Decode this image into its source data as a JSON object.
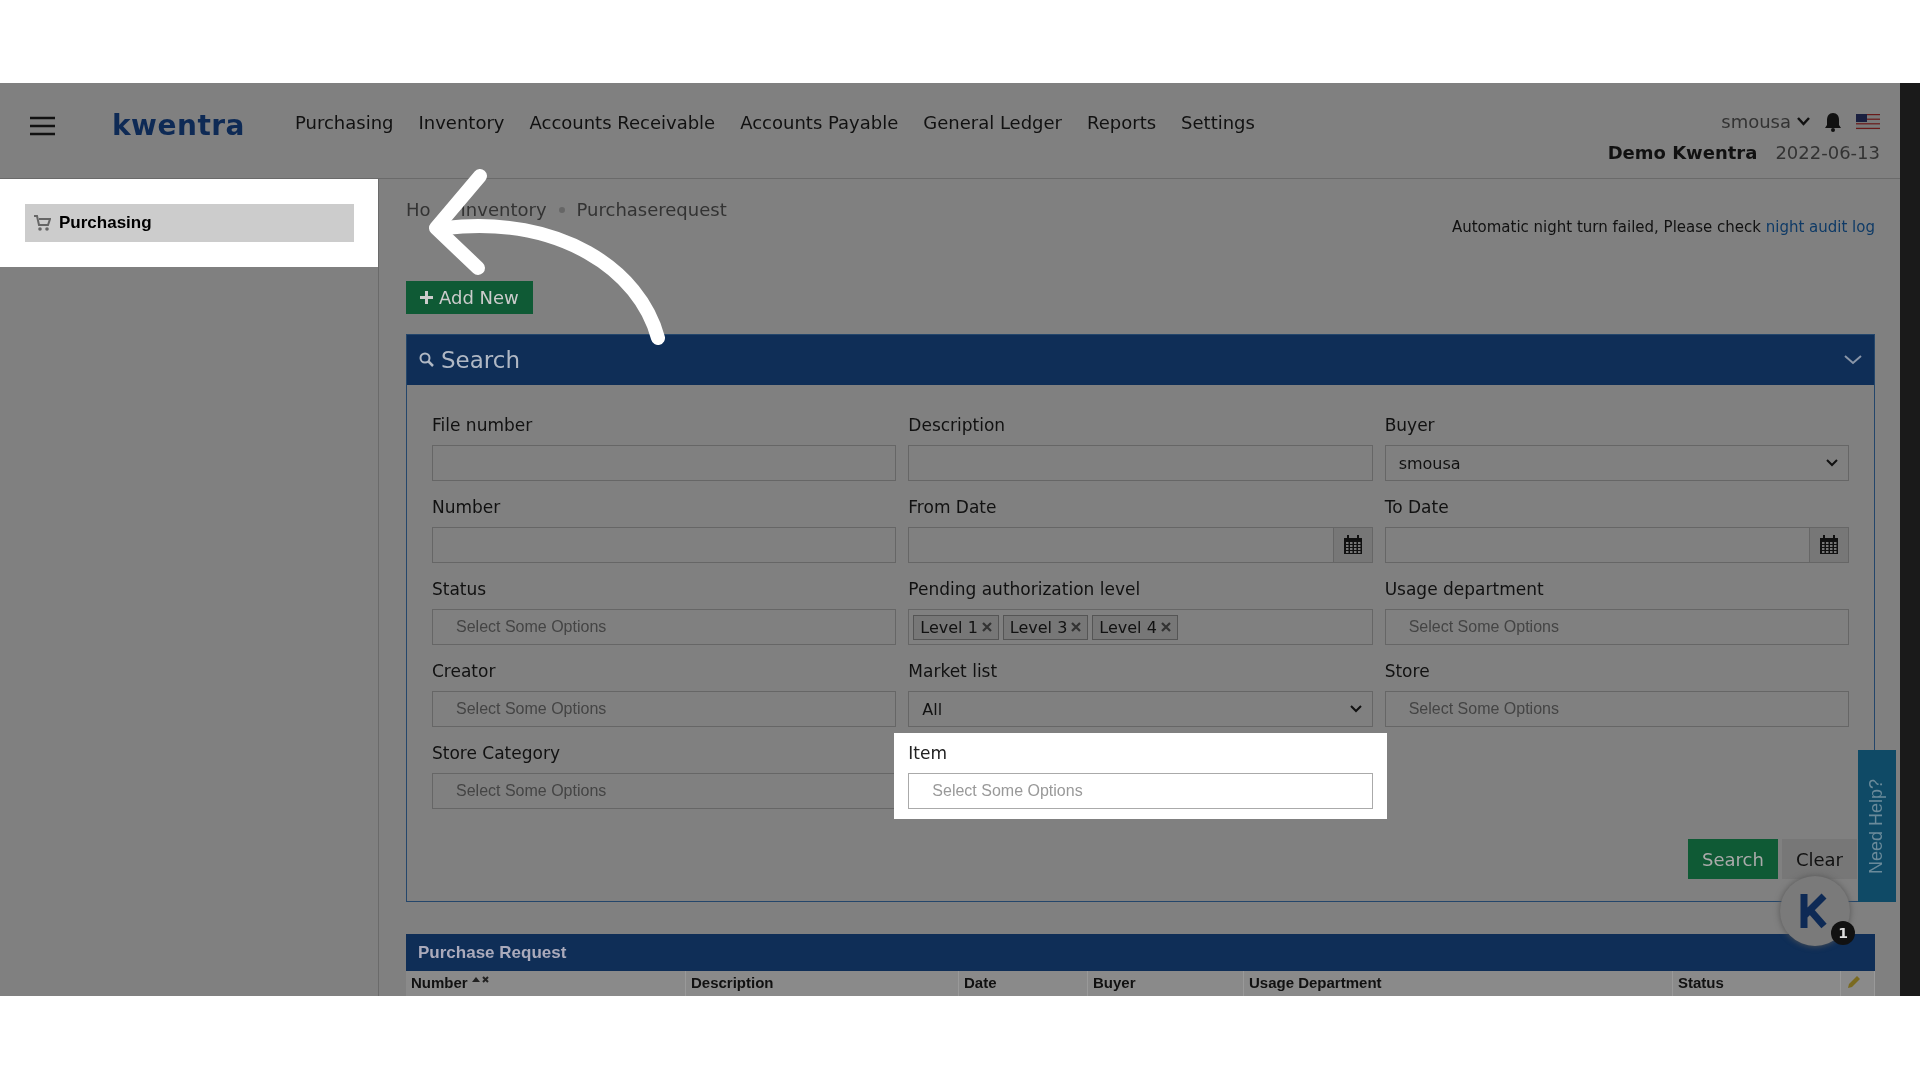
{
  "nav": {
    "logo": "kwentra",
    "menu": [
      "Purchasing",
      "Inventory",
      "Accounts Receivable",
      "Accounts Payable",
      "General Ledger",
      "Reports",
      "Settings"
    ],
    "user": "smousa",
    "company": "Demo Kwentra",
    "date": "2022-06-13"
  },
  "sidebar": {
    "items": [
      {
        "label": "Purchasing",
        "selected": true,
        "highlighted": true
      }
    ]
  },
  "breadcrumb": [
    "Ho",
    "Inventory",
    "Purchaserequest"
  ],
  "notice": {
    "text": "Automatic night turn failed, Please check",
    "link": "night audit log"
  },
  "add_button": "Add New",
  "search_panel": {
    "title": "Search",
    "fields": [
      {
        "label": "File number",
        "kind": "text",
        "highlighted": false
      },
      {
        "label": "Description",
        "kind": "text",
        "highlighted": false
      },
      {
        "label": "Buyer",
        "kind": "select",
        "value": "smousa",
        "highlighted": false
      },
      {
        "label": "Number",
        "kind": "text",
        "highlighted": false
      },
      {
        "label": "From Date",
        "kind": "date",
        "highlighted": false
      },
      {
        "label": "To Date",
        "kind": "date",
        "highlighted": false
      },
      {
        "label": "Status",
        "kind": "multi",
        "placeholder": "Select Some Options",
        "highlighted": false
      },
      {
        "label": "Pending authorization level",
        "kind": "tags",
        "tags": [
          "Level 1",
          "Level 3",
          "Level 4"
        ],
        "highlighted": false
      },
      {
        "label": "Usage department",
        "kind": "multi",
        "placeholder": "Select Some Options",
        "highlighted": false
      },
      {
        "label": "Creator",
        "kind": "multi",
        "placeholder": "Select Some Options",
        "highlighted": false
      },
      {
        "label": "Market list",
        "kind": "select",
        "value": "All",
        "highlighted": false
      },
      {
        "label": "Store",
        "kind": "multi",
        "placeholder": "Select Some Options",
        "highlighted": false
      },
      {
        "label": "Store Category",
        "kind": "multi",
        "placeholder": "Select Some Options",
        "highlighted": false
      },
      {
        "label": "Item",
        "kind": "multi",
        "placeholder": "Select Some Options",
        "highlighted": true
      }
    ],
    "buttons": [
      {
        "label": "Search",
        "kind": "primary"
      },
      {
        "label": "Clear",
        "kind": "secondary"
      }
    ]
  },
  "help_tab": "Need Help?",
  "chat_badge": "1",
  "table": {
    "title": "Purchase Request",
    "columns": [
      {
        "label": "Number",
        "sorted": true
      },
      {
        "label": "Description",
        "sorted": false
      },
      {
        "label": "Date",
        "sorted": false
      },
      {
        "label": "Buyer",
        "sorted": false
      },
      {
        "label": "Usage Department",
        "sorted": false
      },
      {
        "label": "Status",
        "sorted": false
      }
    ]
  }
}
